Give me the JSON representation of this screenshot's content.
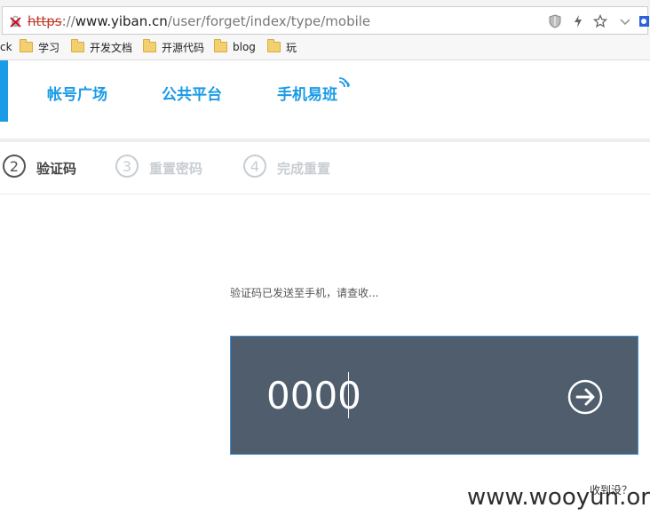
{
  "browser": {
    "url_scheme": "https",
    "url_separator": "://",
    "url_host": "www.yiban.cn",
    "url_path": "/user/forget/index/type/mobile",
    "bookmarks_cut_label": "ck",
    "bookmarks": [
      {
        "label": "学习",
        "icon": "folder-icon"
      },
      {
        "label": "开发文档",
        "icon": "folder-icon"
      },
      {
        "label": "开源代码",
        "icon": "folder-icon"
      },
      {
        "label": "blog",
        "icon": "folder-icon"
      },
      {
        "label": "玩",
        "icon": "folder-icon"
      }
    ]
  },
  "header": {
    "nav": [
      {
        "label": "帐号广场"
      },
      {
        "label": "公共平台"
      },
      {
        "label": "手机易班"
      }
    ]
  },
  "steps": [
    {
      "number": "2",
      "label": "验证码",
      "active": true
    },
    {
      "number": "3",
      "label": "重置密码",
      "active": false
    },
    {
      "number": "4",
      "label": "完成重置",
      "active": false
    }
  ],
  "verify": {
    "hint": "验证码已发送至手机，请查收...",
    "code_value": "0000",
    "not_received": "收到没？"
  },
  "watermark": "www.wooyun.org",
  "colors": {
    "accent": "#1a9be6",
    "panel": "#4f5d6c",
    "step_active": "#555555",
    "step_inactive": "#c8cdd2"
  }
}
